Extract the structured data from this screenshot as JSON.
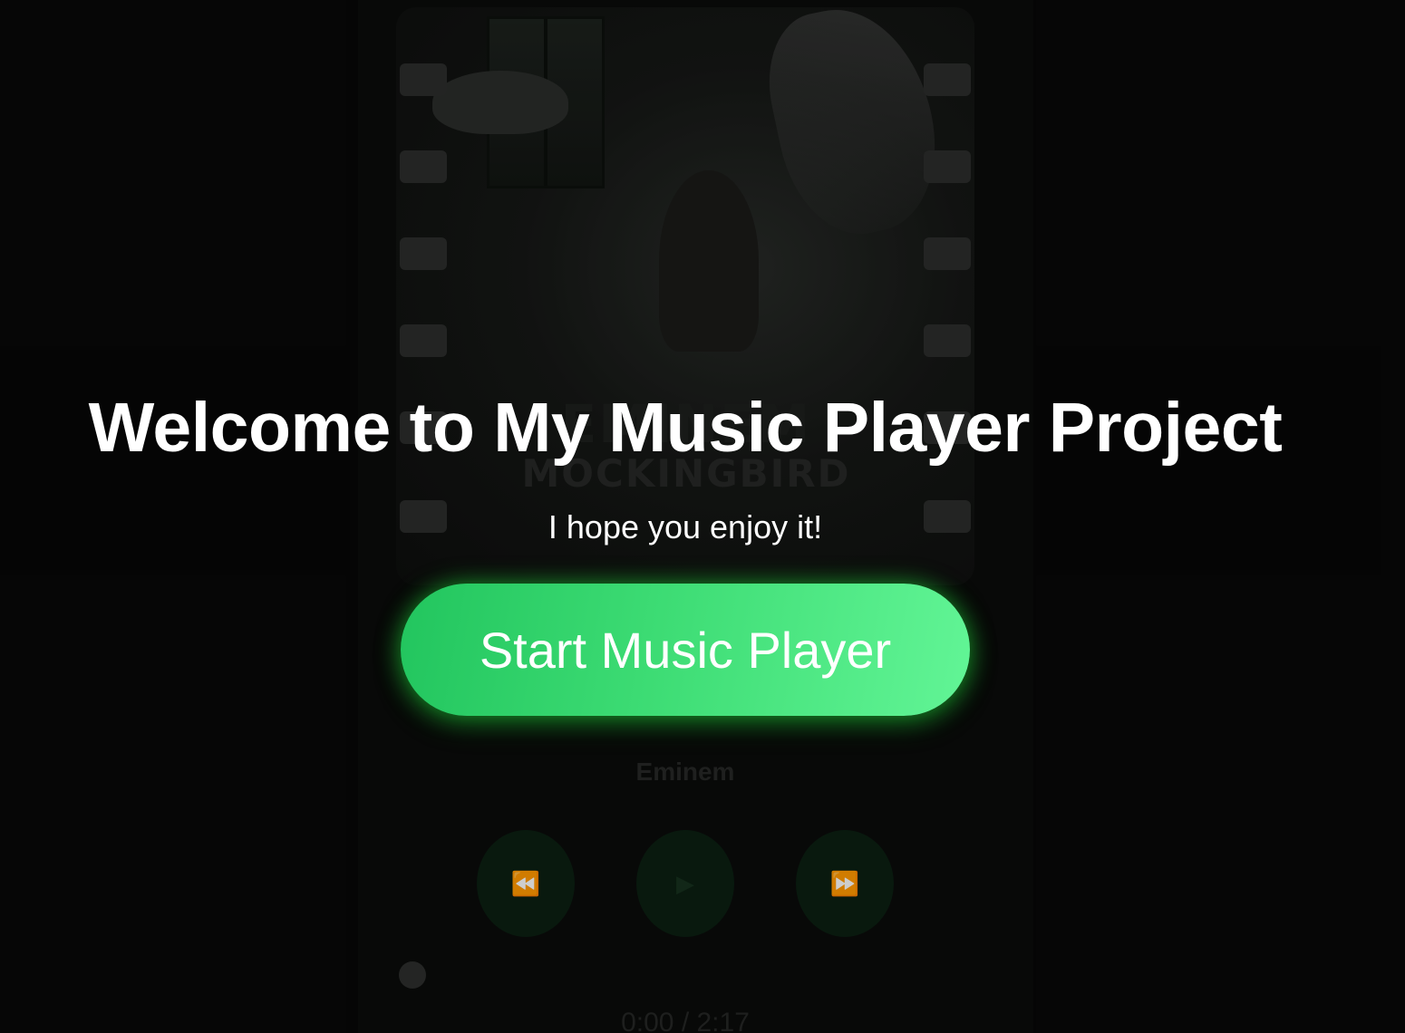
{
  "player": {
    "cover_text_line1": "EMINEM",
    "cover_text_line2": "MOCKINGBIRD",
    "artist": "Eminem",
    "controls": {
      "prev_icon": "rewind-icon",
      "play_icon": "play-icon",
      "next_icon": "fast-forward-icon"
    },
    "time": "0:00 / 2:17",
    "progress": 0
  },
  "welcome": {
    "title": "Welcome to My Music Player Project",
    "subtitle": "I hope you enjoy it!",
    "start_button": "Start Music Player"
  },
  "colors": {
    "accent_start": "#22c55e",
    "accent_end": "#62f596"
  }
}
